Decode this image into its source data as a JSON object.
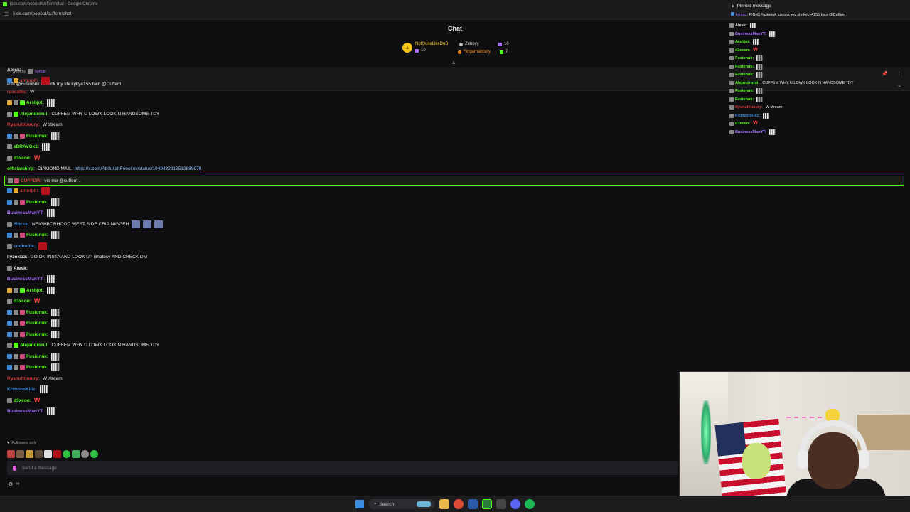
{
  "browser": {
    "window_title": "kick.com/popout/cuffem/chat - Google Chrome",
    "url": "kick.com/popout/cuffem/chat"
  },
  "chat": {
    "title": "Chat",
    "leaderboard": [
      {
        "name": "NotQuiteLikeDuB",
        "gifts": "10",
        "rank": "1"
      },
      {
        "name": "Zebbyy",
        "gifts": "10"
      },
      {
        "name": "Fingamabooty",
        "gifts": "7"
      }
    ],
    "pinned": {
      "sent_by_label": "Sent by",
      "sent_by_user": "kymac",
      "message": "PIN @Fusionnk fusionk my shi kyky4155 twin @Cuffem"
    },
    "messages": [
      {
        "user": "Atesk",
        "text": "",
        "color": "#e8e8e8",
        "emote": "",
        "badges": []
      },
      {
        "user": "anterpli",
        "text": "",
        "color": "#d33b3b",
        "emote": "red",
        "badges": [
          "b-blue",
          "b-gold"
        ]
      },
      {
        "user": "rascalks",
        "text": "W",
        "color": "#d33b3b",
        "emote": "",
        "badges": []
      },
      {
        "user": "Arshjot",
        "text": "",
        "color": "#53fc18",
        "emote": "bars",
        "badges": [
          "b-gold",
          "b-gray",
          "b-green"
        ]
      },
      {
        "user": "Alejandrorui",
        "text": "CUFFEM WHY U LOWK LOOKIN HANDSOME TDY",
        "color": "#53fc18",
        "emote": "",
        "badges": [
          "b-gray",
          "b-green"
        ]
      },
      {
        "user": "Ryanultiooury",
        "text": "W stream",
        "color": "#d33b3b",
        "emote": "",
        "badges": []
      },
      {
        "user": "Fusionnk",
        "text": "",
        "color": "#53fc18",
        "emote": "bars",
        "badges": [
          "b-blue",
          "b-gray",
          "b-pink"
        ]
      },
      {
        "user": "xBRAVOx1",
        "text": "",
        "color": "#53fc18",
        "emote": "bars",
        "badges": [
          "b-gray"
        ]
      },
      {
        "user": "d3xcon",
        "text": "",
        "color": "#53fc18",
        "emote": "w",
        "badges": [
          "b-gray"
        ]
      },
      {
        "user": "officialchirp",
        "text": "DIAMOND MAIL",
        "link": "https://x.com/AbdullahFenol.uv/status/1949432313512889978",
        "color": "#53fc18",
        "emote": "",
        "badges": []
      },
      {
        "user": "CUFFEM",
        "text": "vip me @cuffem .",
        "color": "#d33b3b",
        "emote": "",
        "badges": [
          "b-gray",
          "b-pink"
        ]
      },
      {
        "user": "anterpli",
        "text": "",
        "color": "#d33b3b",
        "emote": "red",
        "badges": [
          "b-blue",
          "b-gold"
        ]
      },
      {
        "user": "Fusionnk",
        "text": "",
        "color": "#53fc18",
        "emote": "bars",
        "badges": [
          "b-blue",
          "b-gray",
          "b-pink"
        ]
      },
      {
        "user": "BusinessManYT",
        "text": "",
        "color": "#a970ff",
        "emote": "bars",
        "badges": []
      },
      {
        "user": "i5licks",
        "text": "NEIGHBORHOOD WEST SIDE CRIP NIGGEH",
        "color": "#3d8bd9",
        "emote": "faces",
        "badges": [
          "b-gray"
        ]
      },
      {
        "user": "Fusionnk",
        "text": "",
        "color": "#53fc18",
        "emote": "bars",
        "badges": [
          "b-blue",
          "b-gray",
          "b-pink"
        ]
      },
      {
        "user": "cooltodie",
        "text": "",
        "color": "#3d8bd9",
        "emote": "red",
        "badges": [
          "b-gray"
        ]
      },
      {
        "user": "ilyzokizz",
        "text": "GO ON INSTA AND LOOK UP ilihatesy AND CHECK DM",
        "color": "#e8e8e8",
        "emote": "",
        "badges": []
      },
      {
        "user": "Atesk",
        "text": "",
        "color": "#e8e8e8",
        "emote": "",
        "badges": [
          "b-gray"
        ]
      },
      {
        "user": "BusinessManYT",
        "text": "",
        "color": "#a970ff",
        "emote": "bars",
        "badges": []
      },
      {
        "user": "Arshjot",
        "text": "",
        "color": "#53fc18",
        "emote": "bars",
        "badges": [
          "b-gold",
          "b-gray",
          "b-green"
        ]
      },
      {
        "user": "d3xcon",
        "text": "",
        "color": "#53fc18",
        "emote": "w",
        "badges": [
          "b-gray"
        ]
      },
      {
        "user": "Fusionnk",
        "text": "",
        "color": "#53fc18",
        "emote": "bars",
        "badges": [
          "b-blue",
          "b-gray",
          "b-pink"
        ]
      },
      {
        "user": "Fusionnk",
        "text": "",
        "color": "#53fc18",
        "emote": "bars",
        "badges": [
          "b-blue",
          "b-gray",
          "b-pink"
        ]
      },
      {
        "user": "Fusionnk",
        "text": "",
        "color": "#53fc18",
        "emote": "bars",
        "badges": [
          "b-blue",
          "b-gray",
          "b-pink"
        ]
      },
      {
        "user": "Alejandrorui",
        "text": "CUFFEM WHY U LOWK LOOKIN HANDSOME TDY",
        "color": "#53fc18",
        "emote": "",
        "badges": [
          "b-gray",
          "b-green"
        ]
      },
      {
        "user": "Fusionnk",
        "text": "",
        "color": "#53fc18",
        "emote": "bars",
        "badges": [
          "b-blue",
          "b-gray",
          "b-pink"
        ]
      },
      {
        "user": "Fusionnk",
        "text": "",
        "color": "#53fc18",
        "emote": "bars",
        "badges": [
          "b-blue",
          "b-gray",
          "b-pink"
        ]
      },
      {
        "user": "Ryanultiooury",
        "text": "W stream",
        "color": "#d33b3b",
        "emote": "",
        "badges": []
      },
      {
        "user": "KrimzonKillz",
        "text": "",
        "color": "#3d8bd9",
        "emote": "bars",
        "badges": []
      },
      {
        "user": "d3xcon",
        "text": "",
        "color": "#53fc18",
        "emote": "w",
        "badges": [
          "b-gray"
        ]
      },
      {
        "user": "BusinessManYT",
        "text": "",
        "color": "#a970ff",
        "emote": "bars",
        "badges": []
      }
    ],
    "followers_only_label": "Followers only",
    "composer_placeholder": "Send a message"
  },
  "overlay": {
    "pinned_title": "Pinned message",
    "pinned_user": "kymac",
    "pinned_text": "PIN @Fusionnk fusionk my shi kyky4155 twin @Cuffem",
    "messages": [
      {
        "user": "Atesk",
        "text": "",
        "color": "#e8e8e8",
        "emote": "bars"
      },
      {
        "user": "BusinessManYT",
        "text": "",
        "color": "#a970ff",
        "emote": "bars"
      },
      {
        "user": "Arshjot",
        "text": "",
        "color": "#53fc18",
        "emote": "bars"
      },
      {
        "user": "d3xcon",
        "text": "",
        "color": "#53fc18",
        "emote": "w"
      },
      {
        "user": "Fusionnk",
        "text": "",
        "color": "#53fc18",
        "emote": "bars"
      },
      {
        "user": "Fusionnk",
        "text": "",
        "color": "#53fc18",
        "emote": "bars"
      },
      {
        "user": "Fusionnk",
        "text": "",
        "color": "#53fc18",
        "emote": "bars"
      },
      {
        "user": "Alejandrorui",
        "text": "CUFFEM WHY U LOWK LOOKIN HANDSOME TDY",
        "color": "#53fc18",
        "emote": ""
      },
      {
        "user": "Fusionnk",
        "text": "",
        "color": "#53fc18",
        "emote": "bars"
      },
      {
        "user": "Fusionnk",
        "text": "",
        "color": "#53fc18",
        "emote": "bars"
      },
      {
        "user": "Ryanultiooury",
        "text": "W stream",
        "color": "#d33b3b",
        "emote": ""
      },
      {
        "user": "KrimzonKillz",
        "text": "",
        "color": "#3d8bd9",
        "emote": "bars"
      },
      {
        "user": "d3xcon",
        "text": "",
        "color": "#53fc18",
        "emote": "w"
      },
      {
        "user": "BusinessManYT",
        "text": "",
        "color": "#a970ff",
        "emote": "bars"
      }
    ]
  },
  "taskbar": {
    "search_label": "Search"
  },
  "colors": {
    "accent": "#53fc18",
    "background": "#0f0f11"
  }
}
